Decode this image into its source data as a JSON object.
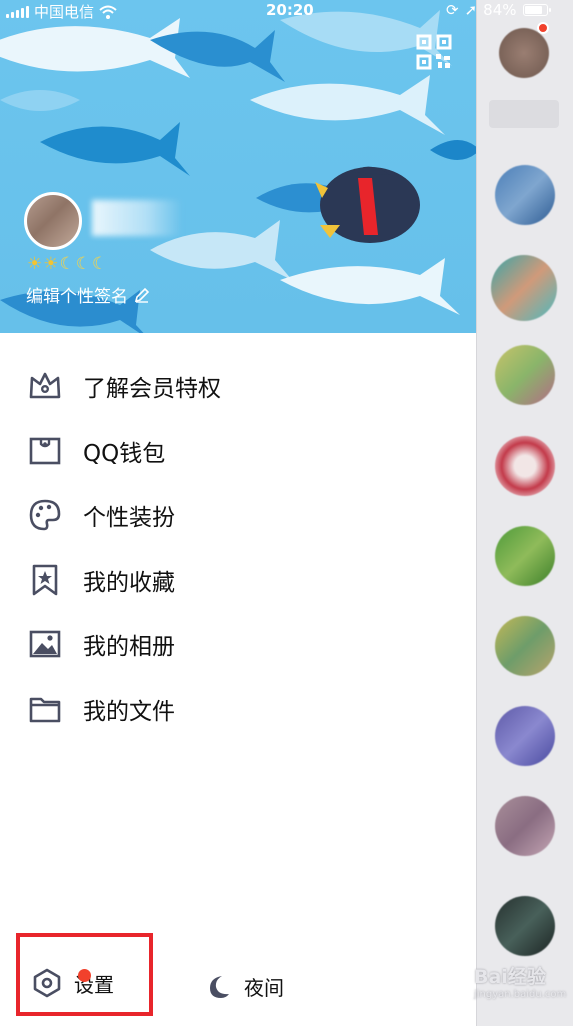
{
  "status_bar": {
    "carrier": "中国电信",
    "time": "20:20",
    "battery": "84%"
  },
  "profile": {
    "level_icons": [
      "sun",
      "sun",
      "moon",
      "moon",
      "moon"
    ],
    "signature_label": "编辑个性签名"
  },
  "menu": {
    "items": [
      {
        "label": "了解会员特权",
        "icon": "crown-icon"
      },
      {
        "label": "QQ钱包",
        "icon": "wallet-icon"
      },
      {
        "label": "个性装扮",
        "icon": "palette-icon"
      },
      {
        "label": "我的收藏",
        "icon": "bookmark-star-icon"
      },
      {
        "label": "我的相册",
        "icon": "image-icon"
      },
      {
        "label": "我的文件",
        "icon": "folder-icon"
      }
    ]
  },
  "bottom": {
    "settings_label": "设置",
    "night_label": "夜间"
  },
  "watermark": {
    "brand": "Bai经验",
    "url": "jingyan.baidu.com"
  },
  "colors": {
    "banner": "#6cc5ee",
    "icon_stroke": "#4a4e62",
    "badge_red": "#f1412c",
    "highlight_red": "#e8252b"
  }
}
